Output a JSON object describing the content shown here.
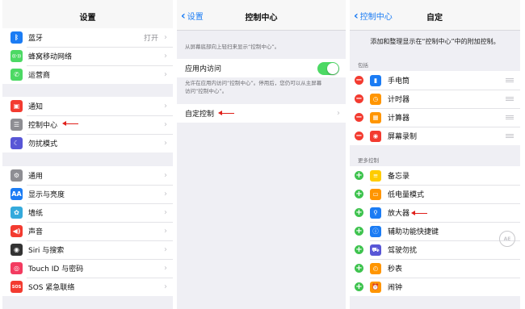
{
  "panel1": {
    "title": "设置",
    "groups": [
      [
        {
          "label": "蓝牙",
          "value": "打开",
          "icon": "bluetooth-icon",
          "color": "#1b7cf4",
          "glyph": "ᛒ"
        },
        {
          "label": "蜂窝移动网络",
          "icon": "cellular-icon",
          "color": "#4cd964",
          "glyph": "((·))"
        },
        {
          "label": "运营商",
          "icon": "phone-icon",
          "color": "#4cd964",
          "glyph": "✆"
        }
      ],
      [
        {
          "label": "通知",
          "icon": "notification-icon",
          "color": "#f33b30",
          "glyph": "▣"
        },
        {
          "label": "控制中心",
          "icon": "control-center-icon",
          "color": "#8e8e93",
          "glyph": "☰"
        },
        {
          "label": "勿扰模式",
          "icon": "moon-icon",
          "color": "#5856d6",
          "glyph": "☾"
        }
      ],
      [
        {
          "label": "通用",
          "icon": "gear-icon",
          "color": "#8e8e93",
          "glyph": "⚙"
        },
        {
          "label": "显示与亮度",
          "icon": "display-icon",
          "color": "#1b7cf4",
          "glyph": "AA"
        },
        {
          "label": "墙纸",
          "icon": "wallpaper-icon",
          "color": "#34aadc",
          "glyph": "✿"
        },
        {
          "label": "声音",
          "icon": "sound-icon",
          "color": "#f33b30",
          "glyph": "◀)"
        },
        {
          "label": "Siri 与搜索",
          "icon": "siri-icon",
          "color": "#333333",
          "glyph": "◉"
        },
        {
          "label": "Touch ID 与密码",
          "icon": "touch-id-icon",
          "color": "#f33b60",
          "glyph": "◎"
        },
        {
          "label": "SOS 紧急联络",
          "icon": "sos-icon",
          "color": "#f33b30",
          "glyph": "SOS"
        }
      ]
    ]
  },
  "panel2": {
    "back": "设置",
    "title": "控制中心",
    "hint1": "从屏幕底部向上轻扫来显示“控制中心”。",
    "app_access_label": "应用内访问",
    "hint2_line1": "允许在应用内访问“控制中心”。停用后，您仍可以从主屏幕",
    "hint2_line2": "访问“控制中心”。",
    "customize_label": "自定控制"
  },
  "panel3": {
    "back": "控制中心",
    "title": "自定",
    "intro": "添加和整理显示在“控制中心”中的附加控制。",
    "included_header": "包括",
    "included": [
      {
        "label": "手电筒",
        "icon": "flashlight-icon",
        "color": "#1b7cf4",
        "glyph": "▮"
      },
      {
        "label": "计时器",
        "icon": "timer-icon",
        "color": "#ff9500",
        "glyph": "◷"
      },
      {
        "label": "计算器",
        "icon": "calculator-icon",
        "color": "#ff9500",
        "glyph": "▦"
      },
      {
        "label": "屏幕录制",
        "icon": "screen-record-icon",
        "color": "#f33b30",
        "glyph": "◉"
      }
    ],
    "more_header": "更多控制",
    "more": [
      {
        "label": "备忘录",
        "icon": "notes-icon",
        "color": "#ffcc00",
        "glyph": "≡"
      },
      {
        "label": "低电量模式",
        "icon": "battery-icon",
        "color": "#ff9500",
        "glyph": "▭"
      },
      {
        "label": "放大器",
        "icon": "magnifier-icon",
        "color": "#1b7cf4",
        "glyph": "⚲"
      },
      {
        "label": "辅助功能快捷键",
        "icon": "accessibility-icon",
        "color": "#1b7cf4",
        "glyph": "ⓘ"
      },
      {
        "label": "驾驶勿扰",
        "icon": "car-icon",
        "color": "#5856d6",
        "glyph": "⛟"
      },
      {
        "label": "秒表",
        "icon": "stopwatch-icon",
        "color": "#ff9500",
        "glyph": "◴"
      },
      {
        "label": "闹钟",
        "icon": "alarm-icon",
        "color": "#ff9500",
        "glyph": "⏰"
      }
    ]
  }
}
